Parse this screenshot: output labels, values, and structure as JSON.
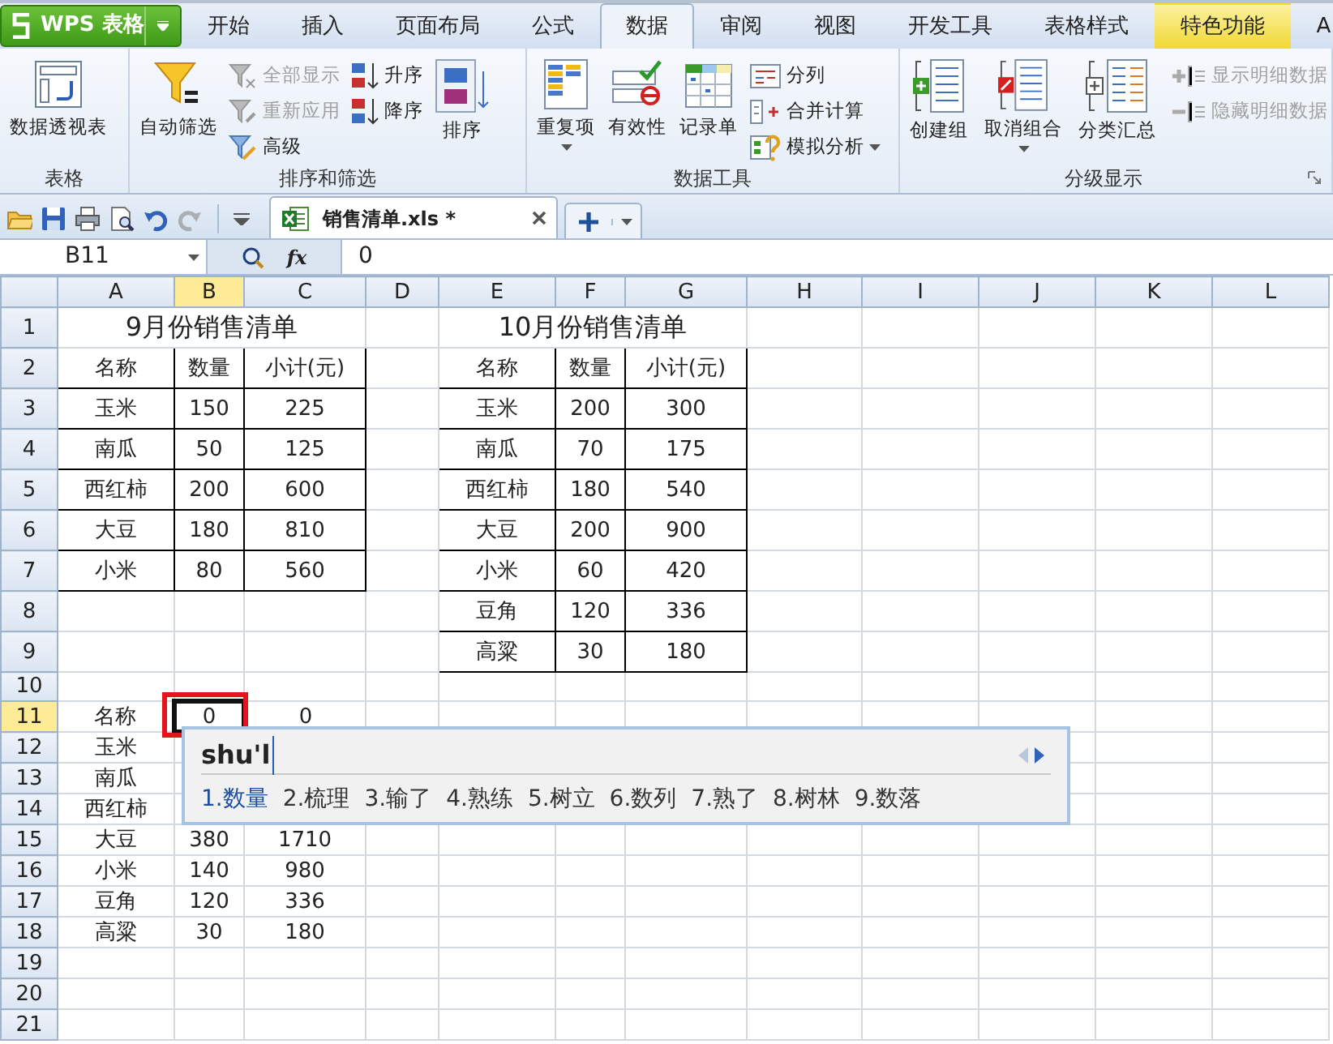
{
  "app_button": {
    "label": "WPS 表格"
  },
  "tabs": [
    {
      "label": "开始",
      "selected": false,
      "highlighted": false
    },
    {
      "label": "插入",
      "selected": false,
      "highlighted": false
    },
    {
      "label": "页面布局",
      "selected": false,
      "highlighted": false
    },
    {
      "label": "公式",
      "selected": false,
      "highlighted": false
    },
    {
      "label": "数据",
      "selected": true,
      "highlighted": false
    },
    {
      "label": "审阅",
      "selected": false,
      "highlighted": false
    },
    {
      "label": "视图",
      "selected": false,
      "highlighted": false
    },
    {
      "label": "开发工具",
      "selected": false,
      "highlighted": false
    },
    {
      "label": "表格样式",
      "selected": false,
      "highlighted": false
    },
    {
      "label": "特色功能",
      "selected": false,
      "highlighted": true
    },
    {
      "label": "A",
      "selected": false,
      "highlighted": false
    }
  ],
  "ribbon_groups": [
    {
      "label": "表格",
      "items": [
        {
          "label": "数据透视表",
          "kind": "large",
          "disabled": false,
          "dropdown": false
        }
      ]
    },
    {
      "label": "排序和筛选",
      "items": [
        {
          "label": "自动筛选",
          "kind": "large",
          "disabled": false,
          "dropdown": false
        },
        {
          "label": "全部显示",
          "kind": "small",
          "disabled": true,
          "dropdown": false
        },
        {
          "label": "重新应用",
          "kind": "small",
          "disabled": true,
          "dropdown": false
        },
        {
          "label": "高级",
          "kind": "small",
          "disabled": false,
          "dropdown": false
        },
        {
          "label": "升序",
          "kind": "small",
          "disabled": false,
          "dropdown": false
        },
        {
          "label": "降序",
          "kind": "small",
          "disabled": false,
          "dropdown": false
        },
        {
          "label": "排序",
          "kind": "large",
          "disabled": false,
          "dropdown": false
        }
      ]
    },
    {
      "label": "数据工具",
      "items": [
        {
          "label": "重复项",
          "kind": "large",
          "disabled": false,
          "dropdown": true
        },
        {
          "label": "有效性",
          "kind": "large",
          "disabled": false,
          "dropdown": false
        },
        {
          "label": "记录单",
          "kind": "large",
          "disabled": false,
          "dropdown": false
        },
        {
          "label": "分列",
          "kind": "small",
          "disabled": false,
          "dropdown": false
        },
        {
          "label": "合并计算",
          "kind": "small",
          "disabled": false,
          "dropdown": false
        },
        {
          "label": "模拟分析",
          "kind": "small",
          "disabled": false,
          "dropdown": true
        }
      ]
    },
    {
      "label": "分级显示",
      "items": [
        {
          "label": "创建组",
          "kind": "large",
          "disabled": false,
          "dropdown": false
        },
        {
          "label": "取消组合",
          "kind": "large",
          "disabled": false,
          "dropdown": true
        },
        {
          "label": "分类汇总",
          "kind": "large",
          "disabled": false,
          "dropdown": false
        },
        {
          "label": "显示明细数据",
          "kind": "small",
          "disabled": true,
          "dropdown": false
        },
        {
          "label": "隐藏明细数据",
          "kind": "small",
          "disabled": true,
          "dropdown": false
        }
      ]
    }
  ],
  "quick_access": [
    {
      "disabled": false
    },
    {
      "disabled": false
    },
    {
      "disabled": false
    },
    {
      "disabled": false
    },
    {
      "disabled": false
    },
    {
      "disabled": true
    }
  ],
  "document_tab": {
    "title": "销售清单.xls *",
    "selected": true
  },
  "formula_bar": {
    "name_box": "B11",
    "fx": "fx",
    "value": "0"
  },
  "columns": [
    {
      "label": "A",
      "selected": false
    },
    {
      "label": "B",
      "selected": true
    },
    {
      "label": "C",
      "selected": false
    },
    {
      "label": "D",
      "selected": false
    },
    {
      "label": "E",
      "selected": false
    },
    {
      "label": "F",
      "selected": false
    },
    {
      "label": "G",
      "selected": false
    },
    {
      "label": "H",
      "selected": false
    },
    {
      "label": "I",
      "selected": false
    },
    {
      "label": "J",
      "selected": false
    },
    {
      "label": "K",
      "selected": false
    },
    {
      "label": "L",
      "selected": false
    }
  ],
  "rows": [
    {
      "label": "1",
      "selected": false,
      "cells": [
        {
          "kind": "title",
          "text": "9月份销售清单",
          "boxed": false,
          "selected": false
        },
        null,
        {
          "kind": "title",
          "text": "10月份销售清单",
          "boxed": false,
          "selected": false
        }
      ]
    },
    {
      "label": "2",
      "selected": false,
      "cells": [
        {
          "kind": "value",
          "text": "名称",
          "boxed": true,
          "selected": false
        },
        {
          "kind": "value",
          "text": "数量",
          "boxed": true,
          "selected": false
        },
        {
          "kind": "value",
          "text": "小计(元)",
          "boxed": true,
          "selected": false
        },
        null,
        {
          "kind": "value",
          "text": "名称",
          "boxed": true,
          "selected": false
        },
        {
          "kind": "value",
          "text": "数量",
          "boxed": true,
          "selected": false
        },
        {
          "kind": "value",
          "text": "小计(元)",
          "boxed": true,
          "selected": false
        }
      ]
    },
    {
      "label": "3",
      "selected": false,
      "cells": [
        {
          "kind": "value",
          "text": "玉米",
          "boxed": true,
          "selected": false
        },
        {
          "kind": "value",
          "text": "150",
          "boxed": true,
          "selected": false
        },
        {
          "kind": "value",
          "text": "225",
          "boxed": true,
          "selected": false
        },
        null,
        {
          "kind": "value",
          "text": "玉米",
          "boxed": true,
          "selected": false
        },
        {
          "kind": "value",
          "text": "200",
          "boxed": true,
          "selected": false
        },
        {
          "kind": "value",
          "text": "300",
          "boxed": true,
          "selected": false
        }
      ]
    },
    {
      "label": "4",
      "selected": false,
      "cells": [
        {
          "kind": "value",
          "text": "南瓜",
          "boxed": true,
          "selected": false
        },
        {
          "kind": "value",
          "text": "50",
          "boxed": true,
          "selected": false
        },
        {
          "kind": "value",
          "text": "125",
          "boxed": true,
          "selected": false
        },
        null,
        {
          "kind": "value",
          "text": "南瓜",
          "boxed": true,
          "selected": false
        },
        {
          "kind": "value",
          "text": "70",
          "boxed": true,
          "selected": false
        },
        {
          "kind": "value",
          "text": "175",
          "boxed": true,
          "selected": false
        }
      ]
    },
    {
      "label": "5",
      "selected": false,
      "cells": [
        {
          "kind": "value",
          "text": "西红柿",
          "boxed": true,
          "selected": false
        },
        {
          "kind": "value",
          "text": "200",
          "boxed": true,
          "selected": false
        },
        {
          "kind": "value",
          "text": "600",
          "boxed": true,
          "selected": false
        },
        null,
        {
          "kind": "value",
          "text": "西红柿",
          "boxed": true,
          "selected": false
        },
        {
          "kind": "value",
          "text": "180",
          "boxed": true,
          "selected": false
        },
        {
          "kind": "value",
          "text": "540",
          "boxed": true,
          "selected": false
        }
      ]
    },
    {
      "label": "6",
      "selected": false,
      "cells": [
        {
          "kind": "value",
          "text": "大豆",
          "boxed": true,
          "selected": false
        },
        {
          "kind": "value",
          "text": "180",
          "boxed": true,
          "selected": false
        },
        {
          "kind": "value",
          "text": "810",
          "boxed": true,
          "selected": false
        },
        null,
        {
          "kind": "value",
          "text": "大豆",
          "boxed": true,
          "selected": false
        },
        {
          "kind": "value",
          "text": "200",
          "boxed": true,
          "selected": false
        },
        {
          "kind": "value",
          "text": "900",
          "boxed": true,
          "selected": false
        }
      ]
    },
    {
      "label": "7",
      "selected": false,
      "cells": [
        {
          "kind": "value",
          "text": "小米",
          "boxed": true,
          "selected": false
        },
        {
          "kind": "value",
          "text": "80",
          "boxed": true,
          "selected": false
        },
        {
          "kind": "value",
          "text": "560",
          "boxed": true,
          "selected": false
        },
        null,
        {
          "kind": "value",
          "text": "小米",
          "boxed": true,
          "selected": false
        },
        {
          "kind": "value",
          "text": "60",
          "boxed": true,
          "selected": false
        },
        {
          "kind": "value",
          "text": "420",
          "boxed": true,
          "selected": false
        }
      ]
    },
    {
      "label": "8",
      "selected": false,
      "cells": [
        null,
        null,
        null,
        null,
        {
          "kind": "value",
          "text": "豆角",
          "boxed": true,
          "selected": false
        },
        {
          "kind": "value",
          "text": "120",
          "boxed": true,
          "selected": false
        },
        {
          "kind": "value",
          "text": "336",
          "boxed": true,
          "selected": false
        }
      ]
    },
    {
      "label": "9",
      "selected": false,
      "cells": [
        null,
        null,
        null,
        null,
        {
          "kind": "value",
          "text": "高粱",
          "boxed": true,
          "selected": false
        },
        {
          "kind": "value",
          "text": "30",
          "boxed": true,
          "selected": false
        },
        {
          "kind": "value",
          "text": "180",
          "boxed": true,
          "selected": false
        }
      ]
    },
    {
      "label": "10",
      "selected": false,
      "cells": []
    },
    {
      "label": "11",
      "selected": true,
      "cells": [
        {
          "kind": "value",
          "text": "名称",
          "selected": false
        },
        {
          "kind": "value",
          "text": "0",
          "selected": true,
          "circled": true
        },
        {
          "kind": "value",
          "text": "0",
          "selected": false
        }
      ]
    },
    {
      "label": "12",
      "selected": false,
      "cells": [
        {
          "kind": "value",
          "text": "玉米",
          "selected": false
        }
      ]
    },
    {
      "label": "13",
      "selected": false,
      "cells": [
        {
          "kind": "value",
          "text": "南瓜",
          "selected": false
        }
      ]
    },
    {
      "label": "14",
      "selected": false,
      "cells": [
        {
          "kind": "value",
          "text": "西红柿",
          "selected": false
        }
      ]
    },
    {
      "label": "15",
      "selected": false,
      "cells": [
        {
          "kind": "value",
          "text": "大豆",
          "selected": false
        },
        {
          "kind": "value",
          "text": "380",
          "selected": false
        },
        {
          "kind": "value",
          "text": "1710",
          "selected": false
        }
      ]
    },
    {
      "label": "16",
      "selected": false,
      "cells": [
        {
          "kind": "value",
          "text": "小米",
          "selected": false
        },
        {
          "kind": "value",
          "text": "140",
          "selected": false
        },
        {
          "kind": "value",
          "text": "980",
          "selected": false
        }
      ]
    },
    {
      "label": "17",
      "selected": false,
      "cells": [
        {
          "kind": "value",
          "text": "豆角",
          "selected": false
        },
        {
          "kind": "value",
          "text": "120",
          "selected": false
        },
        {
          "kind": "value",
          "text": "336",
          "selected": false
        }
      ]
    },
    {
      "label": "18",
      "selected": false,
      "cells": [
        {
          "kind": "value",
          "text": "高粱",
          "selected": false
        },
        {
          "kind": "value",
          "text": "30",
          "selected": false
        },
        {
          "kind": "value",
          "text": "180",
          "selected": false
        }
      ]
    },
    {
      "label": "19",
      "selected": false,
      "cells": []
    },
    {
      "label": "20",
      "selected": false,
      "cells": []
    },
    {
      "label": "21",
      "selected": false,
      "cells": []
    }
  ],
  "ime_popup": {
    "input": "shu'l",
    "candidates": [
      {
        "text": "1.数量",
        "selected": true
      },
      {
        "text": "2.梳理",
        "selected": false
      },
      {
        "text": "3.输了",
        "selected": false
      },
      {
        "text": "4.熟练",
        "selected": false
      },
      {
        "text": "5.树立",
        "selected": false
      },
      {
        "text": "6.数列",
        "selected": false
      },
      {
        "text": "7.熟了",
        "selected": false
      },
      {
        "text": "8.树林",
        "selected": false
      },
      {
        "text": "9.数落",
        "selected": false
      }
    ]
  }
}
